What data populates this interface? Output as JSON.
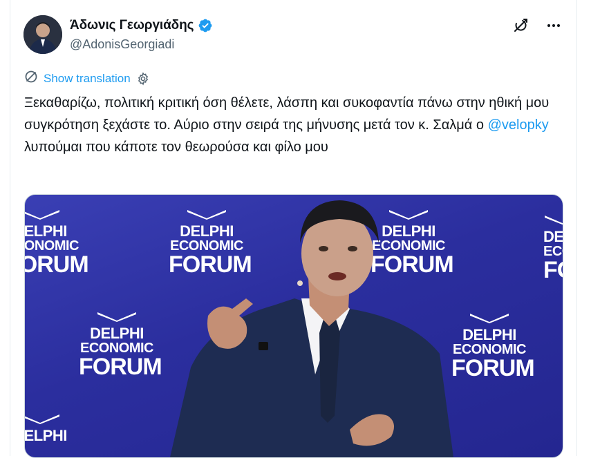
{
  "author": {
    "name": "Άδωνις Γεωργιάδης",
    "handle": "@AdonisGeorgiadi",
    "verified": true
  },
  "translate": {
    "label": "Show translation"
  },
  "tweet": {
    "text_before": "Ξεκαθαρίζω, πολιτική κριτική όση θέλετε, λάσπη και συκοφαντία πάνω στην ηθική μου συγκρότηση ξεχάστε το. Αύριο στην σειρά της μήνυσης μετά τον κ. Σαλμά ο ",
    "mention": "@velopky",
    "text_after": " λυπούμαι που κάποτε τον θεωρούσα και φίλο μου"
  },
  "media": {
    "backdrop_logo": {
      "line1": "DELPHI",
      "line2": "ECONOMIC",
      "line3": "FORUM"
    }
  },
  "colors": {
    "accent": "#1d9bf0",
    "text": "#0f1419",
    "secondary": "#536471",
    "backdrop": "#2f33a6"
  },
  "icons": {
    "grok": "grok-icon",
    "more": "more-icon",
    "translate": "translate-icon",
    "settings": "gear-icon",
    "verified": "verified-badge-icon"
  }
}
